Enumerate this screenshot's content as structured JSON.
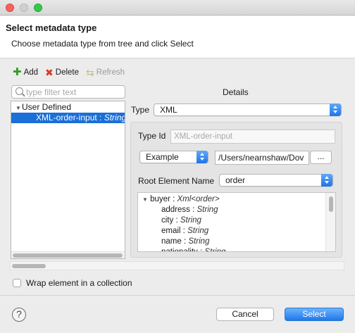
{
  "dialog": {
    "title": "Select metadata type",
    "subtitle": "Choose metadata type from tree and click Select"
  },
  "toolbar": {
    "add_label": "Add",
    "delete_label": "Delete",
    "refresh_label": "Refresh"
  },
  "filter": {
    "placeholder": "type filter text",
    "value": ""
  },
  "tree": {
    "group_label": "User Defined",
    "selected_item_name": "XML-order-input",
    "selected_item_sep": " : ",
    "selected_item_type": "String"
  },
  "details": {
    "heading": "Details",
    "type_label": "Type",
    "type_value": "XML",
    "type_id_label": "Type Id",
    "type_id_placeholder": "XML-order-input",
    "source_value": "Example",
    "path_value": "/Users/nearnshaw/Dov",
    "browse_label": "...",
    "root_label": "Root Element Name",
    "root_value": "order"
  },
  "schema": {
    "root_name": "buyer",
    "root_type": "Xml<order>",
    "fields": [
      {
        "name": "address",
        "type": "String"
      },
      {
        "name": "city",
        "type": "String"
      },
      {
        "name": "email",
        "type": "String"
      },
      {
        "name": "name",
        "type": "String"
      },
      {
        "name": "nationality",
        "type": "String"
      }
    ]
  },
  "options": {
    "wrap_label": "Wrap element in a collection",
    "wrap_checked": false
  },
  "footer": {
    "help_label": "?",
    "cancel_label": "Cancel",
    "select_label": "Select"
  },
  "colors": {
    "selection": "#1a6fd8",
    "primary_button": "#1f78ec",
    "add_icon": "#3a9a2a",
    "delete_icon": "#d83a2a"
  }
}
